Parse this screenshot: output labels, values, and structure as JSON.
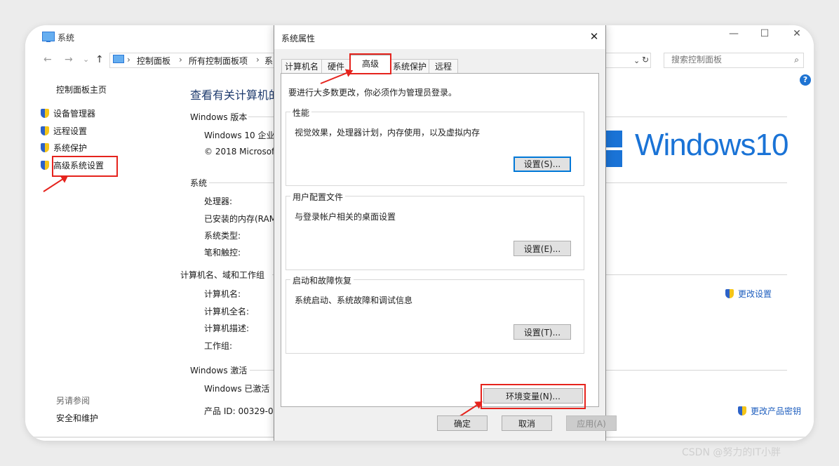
{
  "window": {
    "title": "系统",
    "minimize": "—",
    "maximize": "☐",
    "close": "✕"
  },
  "address_bar": {
    "back": "←",
    "forward": "→",
    "recent": "⌄",
    "up": "↑",
    "crumbs": [
      "控制面板",
      "所有控制面板项",
      "系"
    ],
    "separator": "›",
    "dropdown": "⌄",
    "refresh": "↻",
    "search_placeholder": "搜索控制面板",
    "search_icon": "⌕"
  },
  "help_label": "?",
  "left_nav": {
    "home": "控制面板主页",
    "items": [
      "设备管理器",
      "远程设置",
      "系统保护",
      "高级系统设置"
    ],
    "see_also_title": "另请参阅",
    "see_also_items": [
      "安全和维护"
    ]
  },
  "main": {
    "heading": "查看有关计算机的",
    "edition": {
      "title": "Windows 版本",
      "rows": [
        "Windows 10 企业",
        "© 2018 Microsof"
      ]
    },
    "logo_text": "Windows10",
    "system": {
      "title": "系统",
      "rows": [
        "处理器:",
        "已安装的内存(RAM",
        "系统类型:",
        "笔和触控:"
      ]
    },
    "computer": {
      "title": "计算机名、域和工作组",
      "rows": [
        "计算机名:",
        "计算机全名:",
        "计算机描述:",
        "工作组:"
      ],
      "change_link": "更改设置"
    },
    "activation": {
      "title": "Windows 激活",
      "rows": [
        "Windows 已激活",
        "产品 ID: 00329-00"
      ],
      "change_key_link": "更改产品密钥"
    }
  },
  "dialog": {
    "title": "系统属性",
    "close": "✕",
    "tabs": [
      "计算机名",
      "硬件",
      "高级",
      "系统保护",
      "远程"
    ],
    "active_tab": "高级",
    "hint": "要进行大多数更改，你必须作为管理员登录。",
    "groups": [
      {
        "label": "性能",
        "desc": "视觉效果，处理器计划，内存使用，以及虚拟内存",
        "button": "设置(S)..."
      },
      {
        "label": "用户配置文件",
        "desc": "与登录帐户相关的桌面设置",
        "button": "设置(E)..."
      },
      {
        "label": "启动和故障恢复",
        "desc": "系统启动、系统故障和调试信息",
        "button": "设置(T)..."
      }
    ],
    "env_button": "环境变量(N)...",
    "ok": "确定",
    "cancel": "取消",
    "apply": "应用(A)"
  },
  "watermark": "CSDN @努力的IT小胖",
  "colors": {
    "highlight": "#e5231d",
    "link": "#1f5fbf",
    "brand": "#1a73d6"
  }
}
